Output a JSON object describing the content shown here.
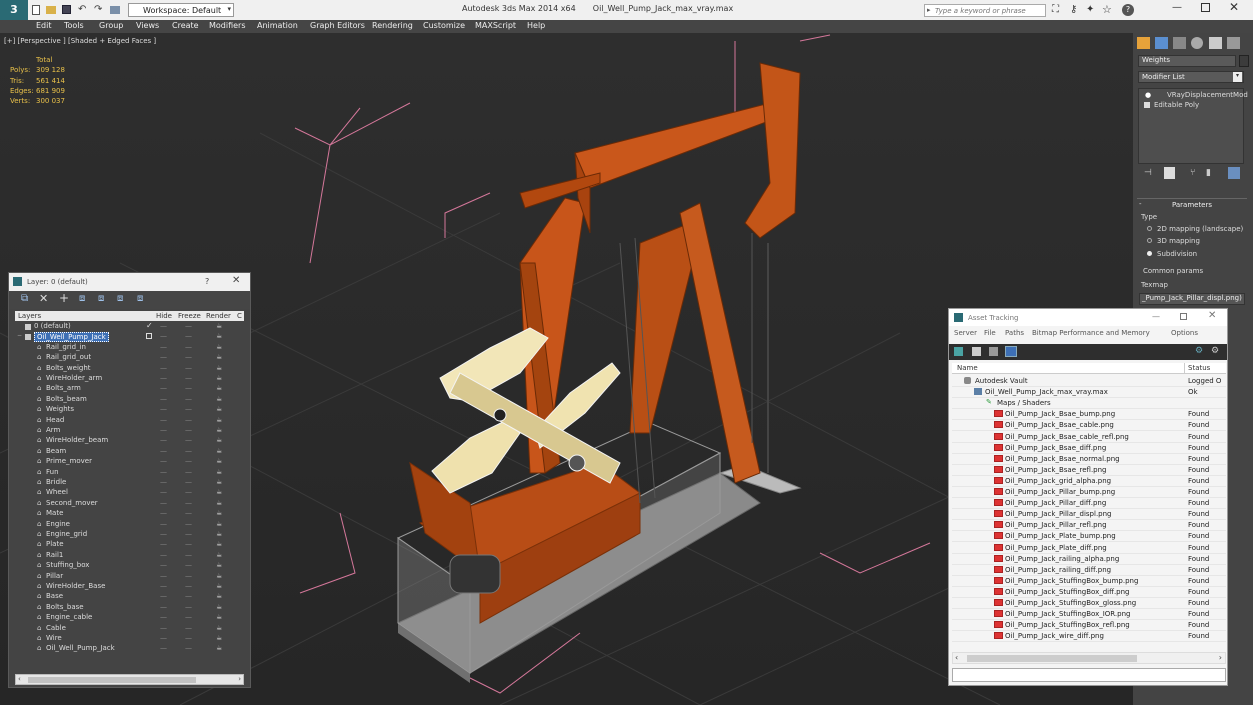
{
  "titlebar": {
    "workspace": "Workspace: Default",
    "app_title": "Autodesk 3ds Max  2014 x64",
    "file_name": "Oil_Well_Pump_Jack_max_vray.max",
    "search_placeholder": "Type a keyword or phrase"
  },
  "menu": [
    "Edit",
    "Tools",
    "Group",
    "Views",
    "Create",
    "Modifiers",
    "Animation",
    "Graph Editors",
    "Rendering",
    "Customize",
    "MAXScript",
    "Help"
  ],
  "viewport": {
    "label": "[+] [Perspective ] [Shaded + Edged Faces ]",
    "stats": {
      "total_label": "Total",
      "rows": [
        {
          "label": "Polys:",
          "value": "309 128"
        },
        {
          "label": "Tris:",
          "value": "561 414"
        },
        {
          "label": "Edges:",
          "value": "681 909"
        },
        {
          "label": "Verts:",
          "value": "300 037"
        }
      ]
    }
  },
  "cmdpanel": {
    "object_name": "Weights",
    "modifier_list": "Modifier List",
    "stack": [
      "VRayDisplacementMod",
      "Editable Poly"
    ],
    "rollout_title": "Parameters",
    "type_label": "Type",
    "type_options": [
      "2D mapping (landscape)",
      "3D mapping",
      "Subdivision"
    ],
    "common_label": "Common params",
    "texmap_label": "Texmap",
    "texmap_value": "_Pump_Jack_Pillar_displ.png)"
  },
  "layer_window": {
    "title": "Layer: 0 (default)",
    "help": "?",
    "columns": [
      "Layers",
      "Hide",
      "Freeze",
      "Render",
      "C"
    ],
    "layers": [
      {
        "name": "0 (default)",
        "level": 0
      },
      {
        "name": "Oil_Well_Pump_Jack",
        "level": 0,
        "selected": true
      },
      {
        "name": "Rail_grid_in",
        "level": 1
      },
      {
        "name": "Rail_grid_out",
        "level": 1
      },
      {
        "name": "Bolts_weight",
        "level": 1
      },
      {
        "name": "WireHolder_arm",
        "level": 1
      },
      {
        "name": "Bolts_arm",
        "level": 1
      },
      {
        "name": "Bolts_beam",
        "level": 1
      },
      {
        "name": "Weights",
        "level": 1
      },
      {
        "name": "Head",
        "level": 1
      },
      {
        "name": "Arm",
        "level": 1
      },
      {
        "name": "WireHolder_beam",
        "level": 1
      },
      {
        "name": "Beam",
        "level": 1
      },
      {
        "name": "Prime_mover",
        "level": 1
      },
      {
        "name": "Fun",
        "level": 1
      },
      {
        "name": "Bridle",
        "level": 1
      },
      {
        "name": "Wheel",
        "level": 1
      },
      {
        "name": "Second_mover",
        "level": 1
      },
      {
        "name": "Mate",
        "level": 1
      },
      {
        "name": "Engine",
        "level": 1
      },
      {
        "name": "Engine_grid",
        "level": 1
      },
      {
        "name": "Plate",
        "level": 1
      },
      {
        "name": "Rail1",
        "level": 1
      },
      {
        "name": "Stuffing_box",
        "level": 1
      },
      {
        "name": "Pillar",
        "level": 1
      },
      {
        "name": "WireHolder_Base",
        "level": 1
      },
      {
        "name": "Base",
        "level": 1
      },
      {
        "name": "Bolts_base",
        "level": 1
      },
      {
        "name": "Engine_cable",
        "level": 1
      },
      {
        "name": "Cable",
        "level": 1
      },
      {
        "name": "Wire",
        "level": 1
      },
      {
        "name": "Oil_Well_Pump_Jack",
        "level": 1
      }
    ]
  },
  "asset_window": {
    "title": "Asset Tracking",
    "menu": [
      "Server",
      "File",
      "Paths",
      "Bitmap Performance and Memory",
      "Options"
    ],
    "columns": [
      "Name",
      "Status"
    ],
    "rows": [
      {
        "name": "Autodesk Vault",
        "status": "Logged O",
        "level": 0
      },
      {
        "name": "Oil_Well_Pump_Jack_max_vray.max",
        "status": "Ok",
        "level": 1
      },
      {
        "name": "Maps / Shaders",
        "status": "",
        "level": 2
      },
      {
        "name": "Oil_Pump_Jack_Bsae_bump.png",
        "status": "Found",
        "level": 3
      },
      {
        "name": "Oil_Pump_Jack_Bsae_cable.png",
        "status": "Found",
        "level": 3
      },
      {
        "name": "Oil_Pump_Jack_Bsae_cable_refl.png",
        "status": "Found",
        "level": 3
      },
      {
        "name": "Oil_Pump_Jack_Bsae_diff.png",
        "status": "Found",
        "level": 3
      },
      {
        "name": "Oil_Pump_Jack_Bsae_normal.png",
        "status": "Found",
        "level": 3
      },
      {
        "name": "Oil_Pump_Jack_Bsae_refl.png",
        "status": "Found",
        "level": 3
      },
      {
        "name": "Oil_Pump_Jack_grid_alpha.png",
        "status": "Found",
        "level": 3
      },
      {
        "name": "Oil_Pump_Jack_Pillar_bump.png",
        "status": "Found",
        "level": 3
      },
      {
        "name": "Oil_Pump_Jack_Pillar_diff.png",
        "status": "Found",
        "level": 3
      },
      {
        "name": "Oil_Pump_Jack_Pillar_displ.png",
        "status": "Found",
        "level": 3
      },
      {
        "name": "Oil_Pump_Jack_Pillar_refl.png",
        "status": "Found",
        "level": 3
      },
      {
        "name": "Oil_Pump_Jack_Plate_bump.png",
        "status": "Found",
        "level": 3
      },
      {
        "name": "Oil_Pump_Jack_Plate_diff.png",
        "status": "Found",
        "level": 3
      },
      {
        "name": "Oil_Pump_Jack_railing_alpha.png",
        "status": "Found",
        "level": 3
      },
      {
        "name": "Oil_Pump_Jack_railing_diff.png",
        "status": "Found",
        "level": 3
      },
      {
        "name": "Oil_Pump_Jack_StuffingBox_bump.png",
        "status": "Found",
        "level": 3
      },
      {
        "name": "Oil_Pump_Jack_StuffingBox_diff.png",
        "status": "Found",
        "level": 3
      },
      {
        "name": "Oil_Pump_Jack_StuffingBox_gloss.png",
        "status": "Found",
        "level": 3
      },
      {
        "name": "Oil_Pump_Jack_StuffingBox_IOR.png",
        "status": "Found",
        "level": 3
      },
      {
        "name": "Oil_Pump_Jack_StuffingBox_refl.png",
        "status": "Found",
        "level": 3
      },
      {
        "name": "Oil_Pump_Jack_wire_diff.png",
        "status": "Found",
        "level": 3
      }
    ]
  },
  "colors": {
    "accent_orange": "#c8551a",
    "selection_blue": "#3d6fb5",
    "wire_white": "#f2f2f2",
    "bbox_pink": "#d4779a"
  }
}
